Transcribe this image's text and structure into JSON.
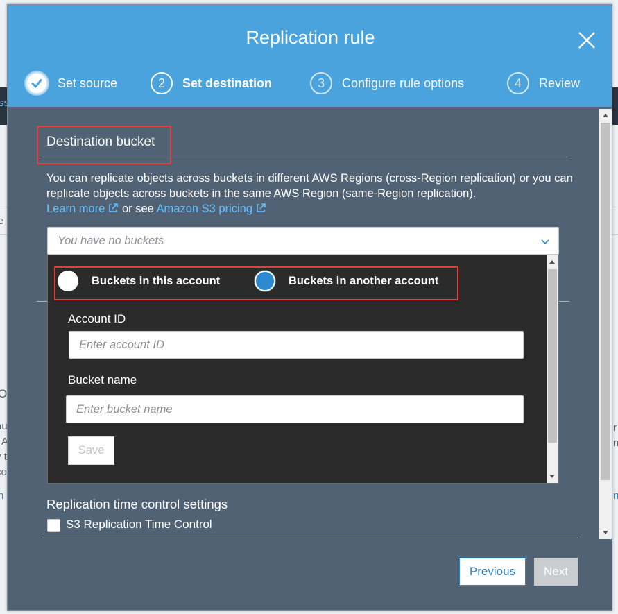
{
  "modal": {
    "title": "Replication rule"
  },
  "steps": [
    {
      "number": "1",
      "label": "Set source",
      "state": "done"
    },
    {
      "number": "2",
      "label": "Set destination",
      "state": "active"
    },
    {
      "number": "3",
      "label": "Configure rule options",
      "state": "pending"
    },
    {
      "number": "4",
      "label": "Review",
      "state": "pending"
    }
  ],
  "destination": {
    "title": "Destination bucket",
    "description": "You can replicate objects across buckets in different AWS Regions (cross-Region replication) or you can replicate objects across buckets in the same AWS Region (same-Region replication).",
    "learn_more": "Learn more",
    "or_see": "or see",
    "pricing_link": "Amazon S3 pricing",
    "select_placeholder": "You have no buckets"
  },
  "dropdown": {
    "radio_this_account": "Buckets in this account",
    "radio_another_account": "Buckets in another account",
    "selected_option": "Buckets in another account",
    "account_id_label": "Account ID",
    "account_id_placeholder": "Enter account ID",
    "bucket_name_label": "Bucket name",
    "bucket_name_placeholder": "Enter bucket name",
    "save_label": "Save"
  },
  "rtc": {
    "title": "Replication time control settings",
    "checkbox_label": "S3 Replication Time Control",
    "checked": false
  },
  "footer": {
    "previous_label": "Previous",
    "next_label": "Next"
  },
  "background": {
    "fragments": [
      "ss",
      "e",
      "O",
      "au",
      "A",
      "y t",
      "co",
      "n",
      "r",
      "n",
      "n"
    ]
  },
  "colors": {
    "header": "#4aa3dc",
    "body": "#506273",
    "dropdown": "#2b2b2b",
    "link": "#62c2ff",
    "highlight": "#e0413a",
    "radio_selected": "#2e8ad0"
  }
}
